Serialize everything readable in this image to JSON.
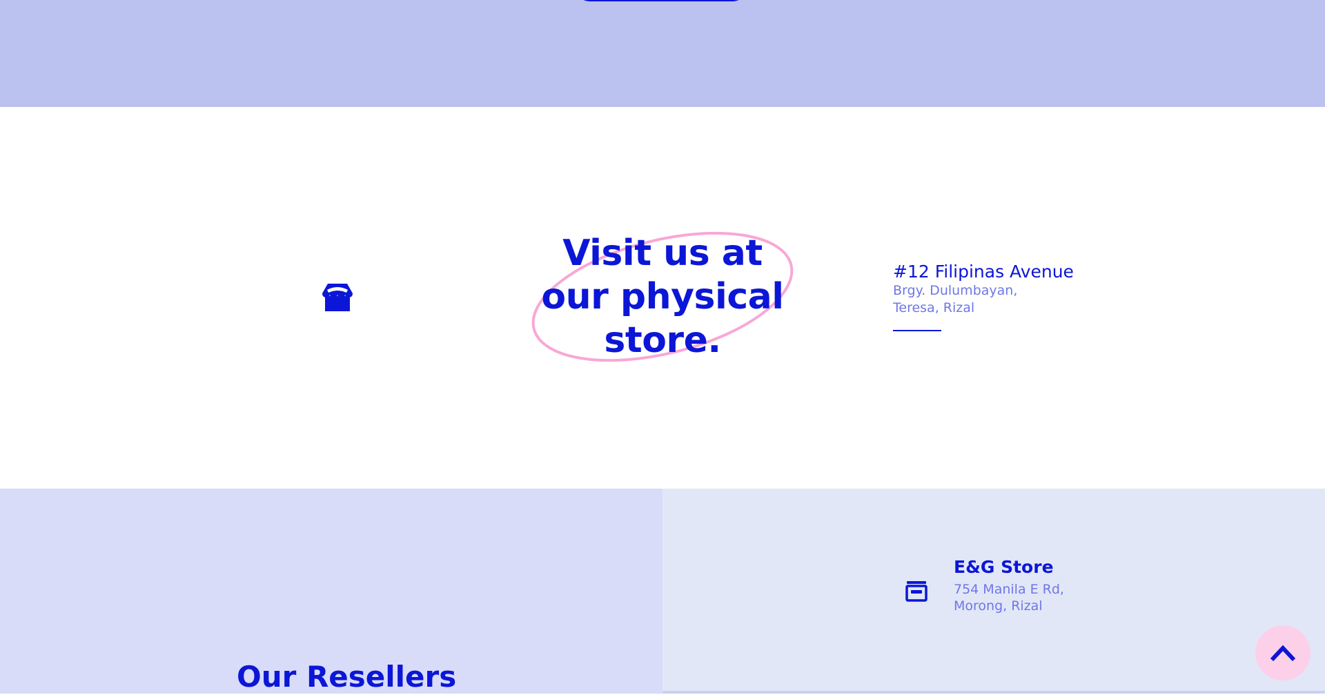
{
  "store": {
    "icon": "storefront-icon",
    "headline": "Visit us at our physical store.",
    "address_line1": "#12 Filipinas Avenue",
    "address_line2": "Brgy. Dulumbayan, Teresa, Rizal"
  },
  "resellers": {
    "title": "Our Resellers",
    "items": [
      {
        "icon": "store-icon",
        "name": "E&G Store",
        "address": "754 Manila E Rd, Morong, Rizal"
      }
    ]
  },
  "scroll_top": {
    "icon": "chevron-up-icon"
  },
  "colors": {
    "accent": "#0c16d6",
    "muted_text": "#6e77e6",
    "top_band": "#bbc2f0",
    "resellers_left_bg": "#d8dcf9",
    "resellers_right_bg": "#e1e7f7",
    "highlight_pink": "#f7a8d6",
    "scroll_button_bg": "#fdd0ea"
  }
}
